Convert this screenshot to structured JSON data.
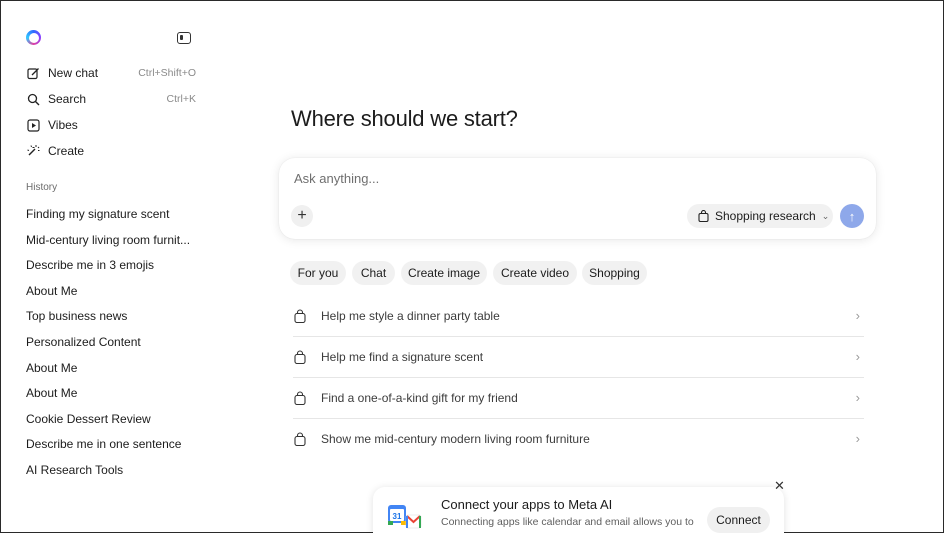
{
  "sidebar": {
    "nav": [
      {
        "label": "New chat",
        "shortcut": "Ctrl+Shift+O",
        "icon": "edit-icon"
      },
      {
        "label": "Search",
        "shortcut": "Ctrl+K",
        "icon": "search-icon"
      },
      {
        "label": "Vibes",
        "shortcut": "",
        "icon": "play-icon"
      },
      {
        "label": "Create",
        "shortcut": "",
        "icon": "sparkle-icon"
      }
    ],
    "history_title": "History",
    "history": [
      "Finding my signature scent",
      "Mid-century living room furnit...",
      "Describe me in 3 emojis",
      "About Me",
      "Top business news",
      "Personalized Content",
      "About Me",
      "About Me",
      "Cookie Dessert Review",
      "Describe me in one sentence",
      "AI Research Tools"
    ]
  },
  "main": {
    "headline": "Where should we start?",
    "composer": {
      "placeholder": "Ask anything...",
      "mode_label": "Shopping research"
    },
    "chips": [
      "For you",
      "Chat",
      "Create image",
      "Create video",
      "Shopping"
    ],
    "selected_chip": "Shopping",
    "suggestions": [
      "Help me style a dinner party table",
      "Help me find a signature scent",
      "Find a one-of-a-kind gift for my friend",
      "Show me mid-century modern living room furniture"
    ]
  },
  "connect_card": {
    "title": "Connect your apps to Meta AI",
    "description": "Connecting apps like calendar and email allows you to",
    "button_label": "Connect"
  },
  "colors": {
    "accent_send": "#8ea8ea",
    "chip_bg": "#f1f1f1"
  }
}
